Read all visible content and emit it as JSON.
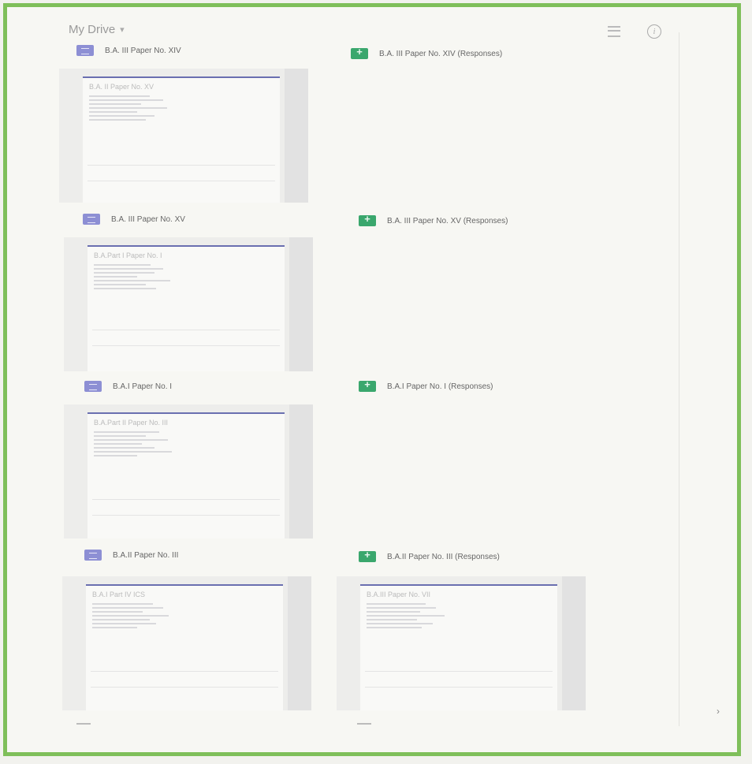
{
  "drive": {
    "title": "My Drive",
    "dropdown_icon": "caret-down-icon",
    "list_view_icon": "list-view-icon",
    "info_icon": "info-icon",
    "info_glyph": "i"
  },
  "files": [
    {
      "name": "B.A. III Paper No. XIV",
      "type": "form",
      "icon": "forms-icon"
    },
    {
      "name": "B.A. III Paper No. XIV (Responses)",
      "type": "sheet",
      "icon": "sheets-icon"
    },
    {
      "name": "B.A. III Paper No. XV",
      "type": "form",
      "icon": "forms-icon"
    },
    {
      "name": "B.A. III Paper No. XV (Responses)",
      "type": "sheet",
      "icon": "sheets-icon"
    },
    {
      "name": "B.A.I Paper No. I",
      "type": "form",
      "icon": "forms-icon"
    },
    {
      "name": "B.A.I Paper No. I (Responses)",
      "type": "sheet",
      "icon": "sheets-icon"
    },
    {
      "name": "B.A.II Paper No. III",
      "type": "form",
      "icon": "forms-icon"
    },
    {
      "name": "B.A.II Paper No. III (Responses)",
      "type": "sheet",
      "icon": "sheets-icon"
    }
  ],
  "thumbnails": [
    {
      "title": "B.A. II Paper No. XV"
    },
    {
      "title": "B.A.Part I Paper No. I"
    },
    {
      "title": "B.A.Part II Paper No. III"
    },
    {
      "title": "B.A.I Part IV ICS"
    },
    {
      "title": "B.A.III Paper No. VII"
    }
  ],
  "next_icon": "chevron-right-icon",
  "next_glyph": "›",
  "accent_colors": {
    "frame": "#7fbf5a",
    "forms": "#8d8fd4",
    "sheets": "#3aa76d"
  }
}
